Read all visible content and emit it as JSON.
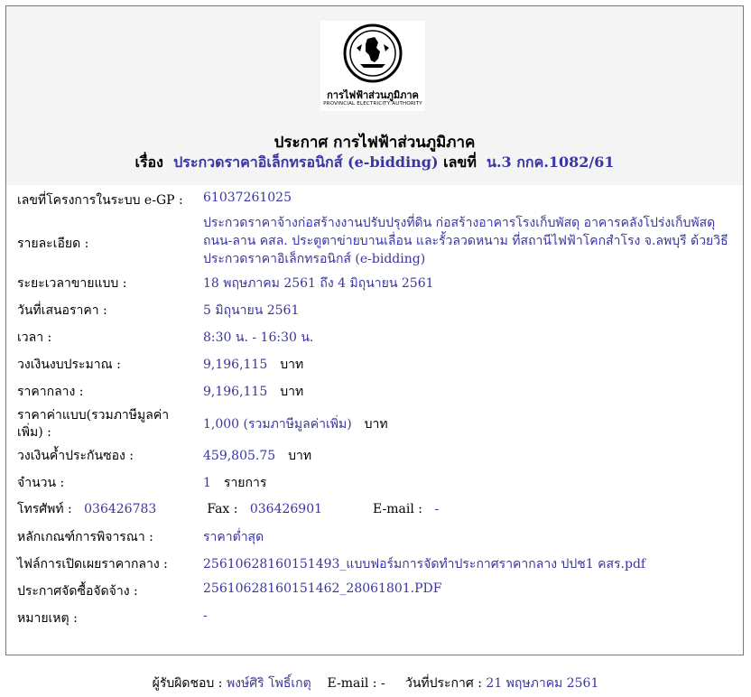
{
  "logo": {
    "name_th": "การไฟฟ้าส่วนภูมิภาค",
    "name_en": "PROVINCIAL ELECTRICITY AUTHORITY"
  },
  "announcement": {
    "title": "ประกาศ การไฟฟ้าส่วนภูมิภาค",
    "subject_label": "เรื่อง",
    "subject": "ประกวดราคาอิเล็กทรอนิกส์ (e-bidding)",
    "number_label": "เลขที่",
    "number": "น.3 กกค.1082/61"
  },
  "fields": {
    "project_no_label": "เลขที่โครงการในระบบ e-GP :",
    "project_no": "61037261025",
    "detail_label": "รายละเอียด :",
    "detail": "ประกวดราคาจ้างก่อสร้างงานปรับปรุงที่ดิน ก่อสร้างอาคารโรงเก็บพัสดุ อาคารคลังโปร่งเก็บพัสดุ ถนน-ลาน คสล. ประตูตาข่ายบานเลื่อน และรั้วลวดหนาม ที่สถานีไฟฟ้าโคกสำโรง จ.ลพบุรี ด้วยวิธีประกวดราคาอิเล็กทรอนิกส์ (e-bidding)",
    "sale_period_label": "ระยะเวลาขายแบบ :",
    "sale_period": "18 พฤษภาคม 2561 ถึง 4 มิถุนายน 2561",
    "bid_date_label": "วันที่เสนอราคา :",
    "bid_date": "5 มิถุนายน 2561",
    "time_label": "เวลา :",
    "time": "8:30 น. - 16:30 น.",
    "budget_label": "วงเงินงบประมาณ :",
    "budget": "9,196,115",
    "budget_unit": "บาท",
    "median_label": "ราคากลาง :",
    "median": "9,196,115",
    "median_unit": "บาท",
    "doc_price_label_1": "ราคาค่าแบบ(รวมภาษีมูลค่า",
    "doc_price_label_2": "เพิ่ม) :",
    "doc_price": "1,000 (รวมภาษีมูลค่าเพิ่ม)",
    "doc_price_unit": "บาท",
    "guarantee_label": "วงเงินค้ำประกันซอง :",
    "guarantee": "459,805.75",
    "guarantee_unit": "บาท",
    "quantity_label": "จำนวน :",
    "quantity": "1",
    "quantity_unit": "รายการ",
    "phone_label": "โทรศัพท์ :",
    "phone": "036426783",
    "fax_label": "Fax :",
    "fax": "036426901",
    "email_label": "E-mail :",
    "email": "-",
    "criteria_label": "หลักเกณฑ์การพิจารณา :",
    "criteria": "ราคาต่ำสุด",
    "median_file_label": "ไฟล์การเปิดเผยราคากลาง :",
    "median_file": "25610628160151493_แบบฟอร์มการจัดทำประกาศราคากลาง ปปช1 คสร.pdf",
    "procurement_label": "ประกาศจัดซื้อจัดจ้าง :",
    "procurement_file": "25610628160151462_28061801.PDF",
    "remark_label": "หมายเหตุ :",
    "remark": "-"
  },
  "footer": {
    "responsible_label": "ผู้รับผิดชอบ :",
    "responsible": "พงษ์ศิริ โพธิ์เกตุ",
    "email_label": "E-mail :",
    "email": "-",
    "announce_date_label": "วันที่ประกาศ :",
    "announce_date": "21 พฤษภาคม 2561"
  },
  "colors": {
    "link": "#3a35a0",
    "header_bg": "#f4f4f4",
    "border": "#7a7a7a"
  }
}
